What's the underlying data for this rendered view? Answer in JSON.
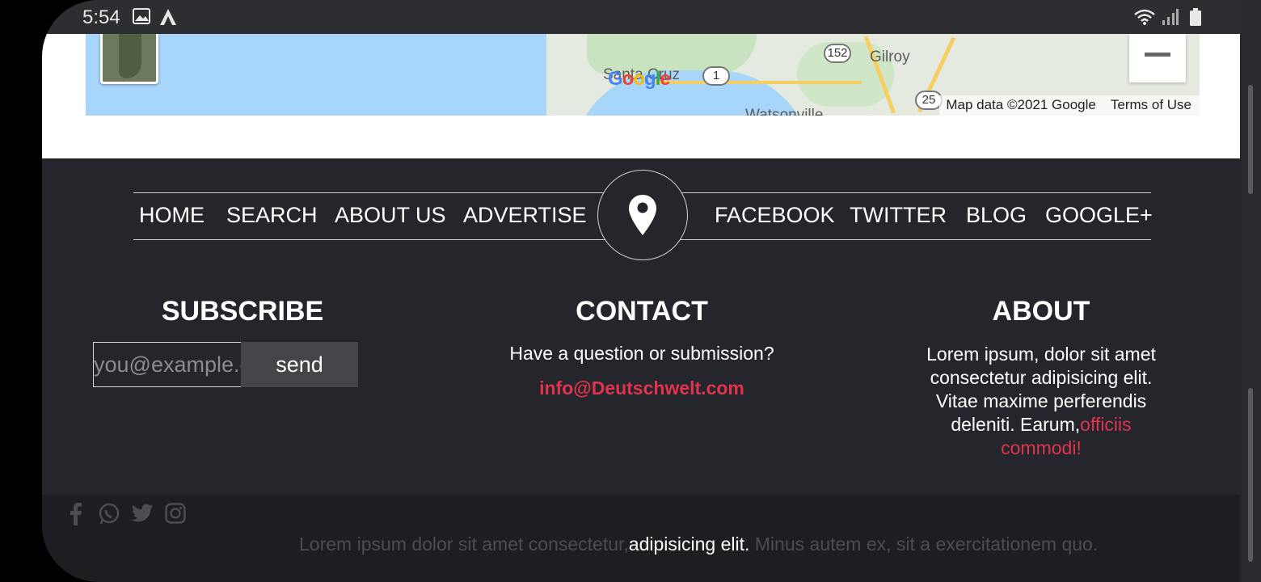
{
  "status_bar": {
    "time": "5:54",
    "left_icons": [
      "image-icon",
      "a-icon"
    ],
    "right_icons": [
      "wifi-icon",
      "signal-icon",
      "battery-icon"
    ]
  },
  "map": {
    "labels": [
      "Gilroy",
      "Santa Cruz",
      "Watsonville"
    ],
    "route_shields": [
      "152",
      "1",
      "25"
    ],
    "logo": "Google",
    "attribution": "Map data ©2021 Google",
    "terms_link": "Terms of Use",
    "zoom_out_icon": "minus-icon"
  },
  "nav": {
    "left": [
      "HOME",
      "SEARCH",
      "ABOUT US",
      "ADVERTISE"
    ],
    "right": [
      "FACEBOOK",
      "TWITTER",
      "BLOG",
      "GOOGLE+"
    ],
    "center_icon": "map-pin-icon"
  },
  "subscribe": {
    "title": "SUBSCRIBE",
    "placeholder": "you@example.com",
    "button": "send"
  },
  "contact": {
    "title": "CONTACT",
    "text": "Have a question or submission?",
    "email": "info@Deutschwelt.com"
  },
  "about": {
    "title": "ABOUT",
    "text": "Lorem ipsum, dolor sit amet consectetur adipisicing elit. Vitae maxime perferendis deleniti. Earum,",
    "highlight": "officiis commodi!"
  },
  "bottom": {
    "social_icons": [
      "facebook-icon",
      "whatsapp-icon",
      "twitter-icon",
      "instagram-icon"
    ],
    "copyright_pre": "Lorem ipsum dolor sit amet consectetur,",
    "copyright_highlight": "adipisicing elit.",
    "copyright_post": " Minus autem ex, sit a exercitationem quo."
  },
  "colors": {
    "accent_red": "#e0334d",
    "footer_bg": "#24262b",
    "bottom_bg": "#1d1e21",
    "map_water": "#a8d6fb"
  }
}
